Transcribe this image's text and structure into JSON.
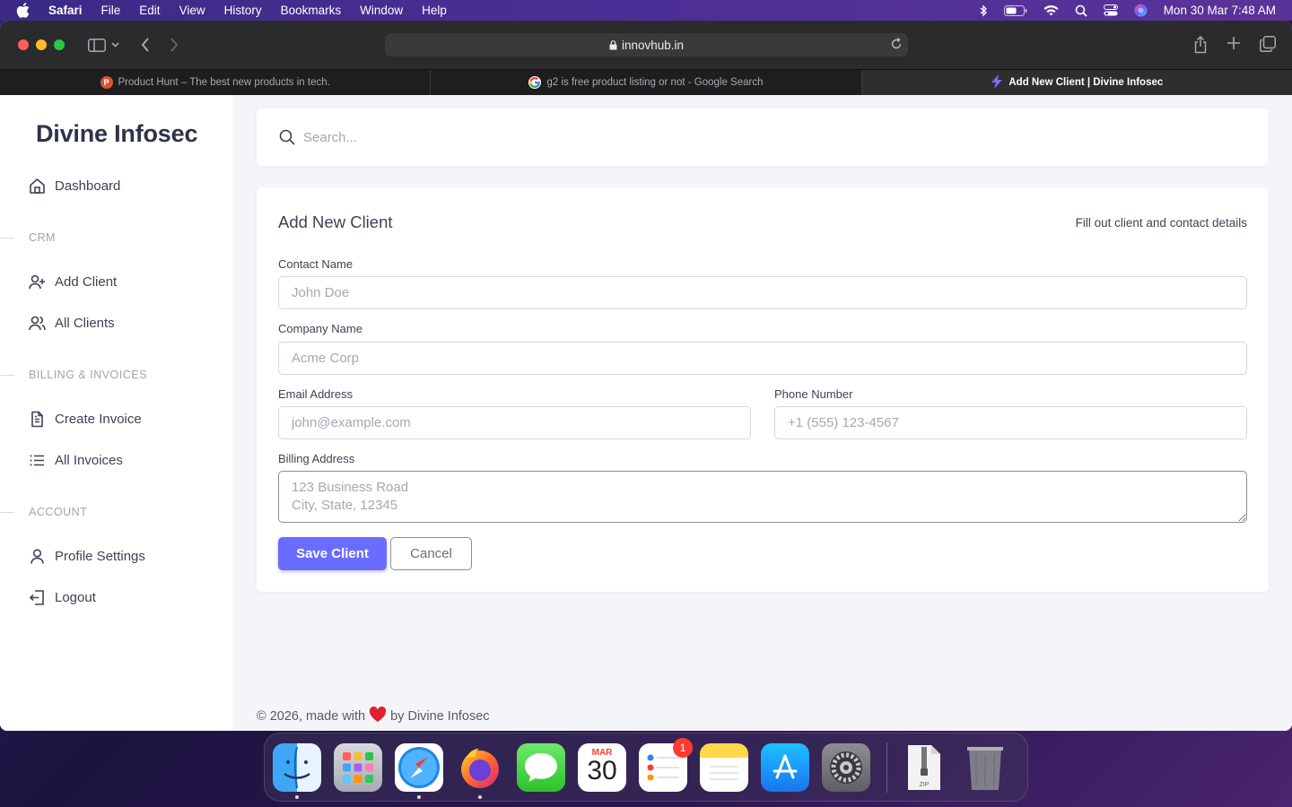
{
  "menubar": {
    "app": "Safari",
    "items": [
      "File",
      "Edit",
      "View",
      "History",
      "Bookmarks",
      "Window",
      "Help"
    ],
    "clock": "Mon 30 Mar  7:48 AM"
  },
  "browser": {
    "url": "innovhub.in",
    "tabs": [
      {
        "title": "Product Hunt – The best new products in tech."
      },
      {
        "title": "g2 is free product listing or not - Google Search"
      },
      {
        "title": "Add New Client | Divine Infosec"
      }
    ]
  },
  "sidebar": {
    "brand": "Divine Infosec",
    "dashboard": "Dashboard",
    "sections": {
      "crm": "CRM",
      "billing": "BILLING & INVOICES",
      "account": "ACCOUNT"
    },
    "items": {
      "add_client": "Add Client",
      "all_clients": "All Clients",
      "create_invoice": "Create Invoice",
      "all_invoices": "All Invoices",
      "profile_settings": "Profile Settings",
      "logout": "Logout"
    }
  },
  "search": {
    "placeholder": "Search..."
  },
  "form": {
    "title": "Add New Client",
    "subtitle": "Fill out client and contact details",
    "contact_name": {
      "label": "Contact Name",
      "placeholder": "John Doe",
      "value": ""
    },
    "company_name": {
      "label": "Company Name",
      "placeholder": "Acme Corp",
      "value": ""
    },
    "email": {
      "label": "Email Address",
      "placeholder": "john@example.com",
      "value": ""
    },
    "phone": {
      "label": "Phone Number",
      "placeholder": "+1 (555) 123-4567",
      "value": ""
    },
    "billing_address": {
      "label": "Billing Address",
      "placeholder": "123 Business Road\nCity, State, 12345",
      "value": ""
    },
    "save_label": "Save Client",
    "cancel_label": "Cancel"
  },
  "footer": {
    "prefix": "© 2026, made with",
    "suffix": "by Divine Infosec"
  },
  "dock": {
    "calendar_month": "MAR",
    "calendar_day": "30",
    "reminders_badge": "1",
    "zip_label": "ZIP"
  },
  "colors": {
    "primary": "#696cff",
    "text": "#3f4254",
    "muted": "#a1a3b3"
  }
}
